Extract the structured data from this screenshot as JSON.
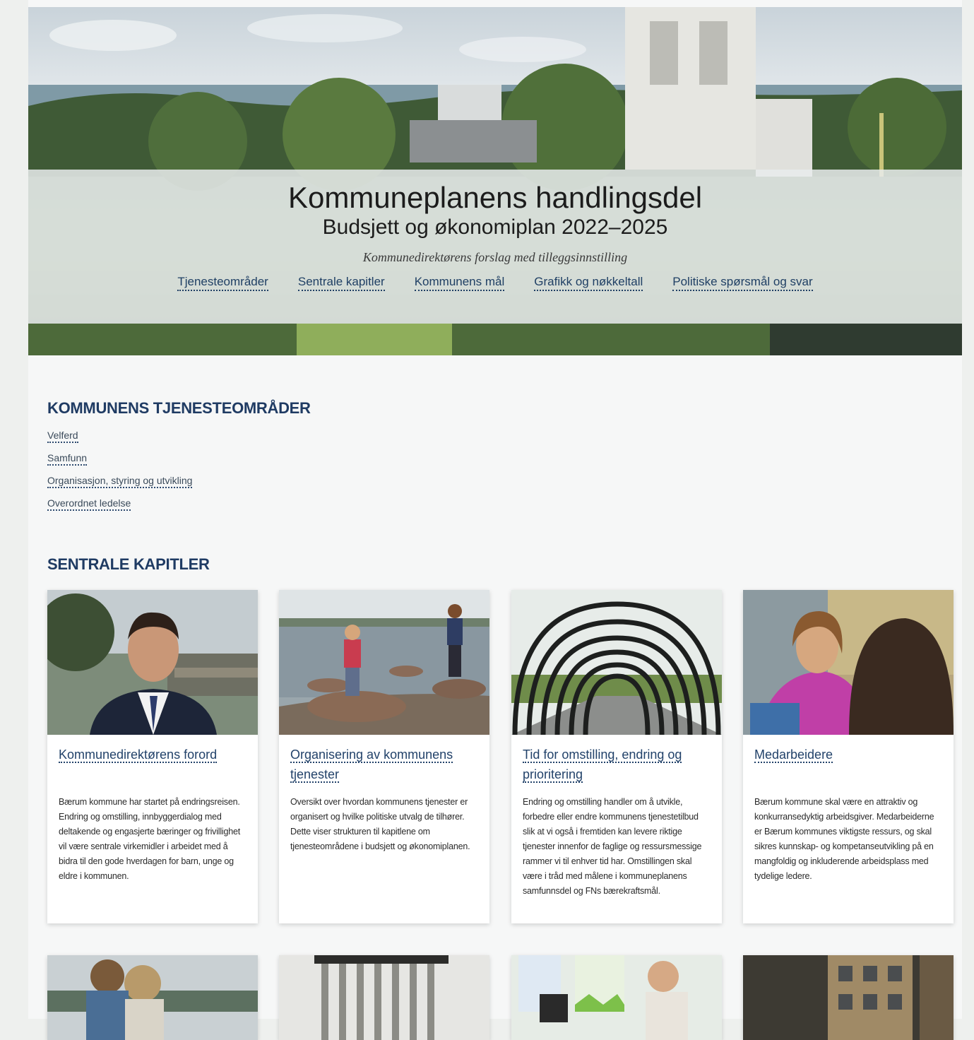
{
  "hero": {
    "title": "Kommuneplanens handlingsdel",
    "subtitle": "Budsjett og økonomiplan 2022–2025",
    "lead": "Kommunedirektørens forslag med tilleggsinnstilling",
    "nav": [
      {
        "label": "Tjenesteområder"
      },
      {
        "label": "Sentrale kapitler"
      },
      {
        "label": "Kommunens mål"
      },
      {
        "label": "Grafikk og nøkkeltall"
      },
      {
        "label": "Politiske spørsmål og svar"
      }
    ]
  },
  "services": {
    "heading": "KOMMUNENS TJENESTEOMRÅDER",
    "items": [
      {
        "label": "Velferd"
      },
      {
        "label": "Samfunn"
      },
      {
        "label": "Organisasjon, styring og utvikling"
      },
      {
        "label": "Overordnet ledelse"
      }
    ]
  },
  "chapters": {
    "heading": "SENTRALE KAPITLER",
    "cards": [
      {
        "title": "Kommunedirektørens forord",
        "text": "Bærum kommune har startet på endringsreisen. Endring og omstilling, innbyggerdialog med deltakende og engasjerte bæringer og frivillighet vil være sentrale virkemidler i arbeidet med å bidra til den gode hverdagen for barn, unge og eldre i kommunen.",
        "image": "portrait-man-in-suit"
      },
      {
        "title": "Organisering av kommunens tjenester",
        "text": "Oversikt over hvordan kommunens tjenester er organisert og hvilke politiske utvalg de tilhører. Dette viser strukturen til kapitlene om tjenesteområdene i budsjett og økonomiplanen.",
        "image": "children-on-stones-by-lake"
      },
      {
        "title": "Tid for omstilling, endring og prioritering",
        "text": "Endring og omstilling handler om å utvikle, forbedre eller endre kommunens tjenestetilbud slik at vi også i fremtiden kan levere riktige tjenester innenfor de faglige og ressursmessige rammer vi til enhver tid har. Omstillingen skal være i tråd med målene i kommuneplanens samfunnsdel og FNs bærekraftsmål.",
        "image": "arch-tunnel"
      },
      {
        "title": "Medarbeidere",
        "text": "Bærum kommune skal være en attraktiv og konkurransedyktig arbeidsgiver. Medarbeiderne er Bærum kommunes viktigste ressurs, og skal sikres kunnskap- og kompetanseutvikling på en mangfoldig og inkluderende arbeidsplass med tydelige ledere.",
        "image": "woman-at-laptop"
      }
    ]
  }
}
